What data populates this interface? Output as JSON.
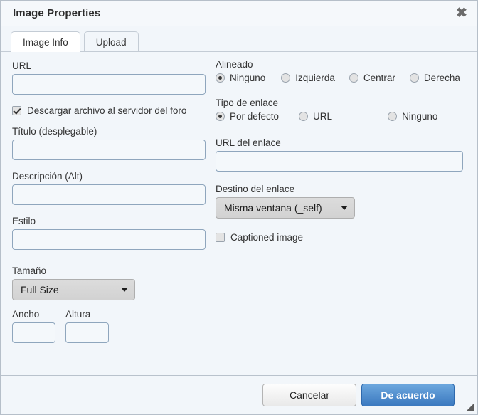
{
  "dialog": {
    "title": "Image Properties",
    "close_icon": "close-icon"
  },
  "tabs": [
    {
      "label": "Image Info",
      "active": true
    },
    {
      "label": "Upload",
      "active": false
    }
  ],
  "left_column": {
    "url": {
      "label": "URL",
      "value": "",
      "placeholder": ""
    },
    "upload_checkbox": {
      "label": "Descargar archivo al servidor del foro",
      "checked": true
    },
    "title_field": {
      "label": "Título (desplegable)",
      "value": "",
      "placeholder": ""
    },
    "description": {
      "label": "Descripción (Alt)",
      "value": "",
      "placeholder": ""
    },
    "style": {
      "label": "Estilo",
      "value": "",
      "placeholder": ""
    },
    "size": {
      "label": "Tamaño",
      "selected": "Full Size",
      "arrow_icon": "chevron-down-icon"
    },
    "width": {
      "label": "Ancho",
      "value": "",
      "placeholder": ""
    },
    "height": {
      "label": "Altura",
      "value": "",
      "placeholder": ""
    }
  },
  "right_column": {
    "align": {
      "label": "Alineado",
      "options": [
        {
          "label": "Ninguno",
          "selected": true
        },
        {
          "label": "Izquierda",
          "selected": false
        },
        {
          "label": "Centrar",
          "selected": false
        },
        {
          "label": "Derecha",
          "selected": false
        }
      ]
    },
    "link_type": {
      "label": "Tipo de enlace",
      "options": [
        {
          "label": "Por defecto",
          "selected": true
        },
        {
          "label": "URL",
          "selected": false
        },
        {
          "label": "Ninguno",
          "selected": false
        }
      ]
    },
    "link_url": {
      "label": "URL del enlace",
      "value": "",
      "placeholder": ""
    },
    "link_target": {
      "label": "Destino del enlace",
      "selected": "Misma ventana (_self)",
      "arrow_icon": "chevron-down-icon"
    },
    "captioned": {
      "label": "Captioned image",
      "checked": false
    }
  },
  "footer": {
    "cancel_label": "Cancelar",
    "ok_label": "De acuerdo",
    "resize_grip_icon": "resize-grip-icon"
  },
  "colors": {
    "dialog_background": "#f2f6fa",
    "titlebar_background": "#f5f8fb",
    "input_border": "#8fa6bd",
    "primary_button": "#3b79c0",
    "border": "#c4ccd5"
  }
}
